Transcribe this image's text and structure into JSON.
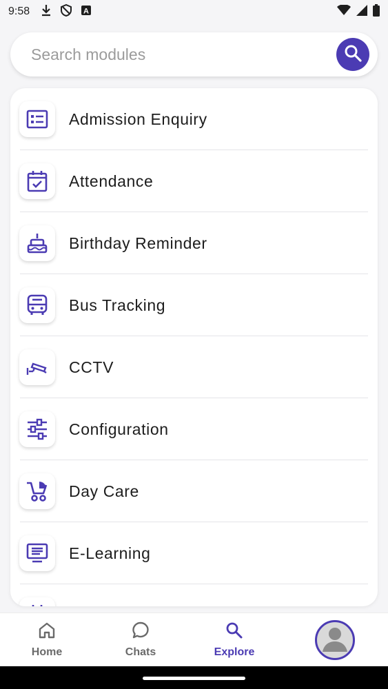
{
  "status_bar": {
    "time": "9:58",
    "icons_left": [
      "download-icon",
      "shield-icon",
      "app-a-icon"
    ],
    "icons_right": [
      "wifi-icon",
      "signal-icon",
      "battery-icon"
    ]
  },
  "search": {
    "placeholder": "Search modules",
    "value": ""
  },
  "modules": [
    {
      "label": "Admission Enquiry",
      "icon": "form-list-icon"
    },
    {
      "label": "Attendance",
      "icon": "calendar-check-icon"
    },
    {
      "label": "Birthday Reminder",
      "icon": "cake-icon"
    },
    {
      "label": "Bus Tracking",
      "icon": "bus-icon"
    },
    {
      "label": "CCTV",
      "icon": "cctv-camera-icon"
    },
    {
      "label": "Configuration",
      "icon": "sliders-icon"
    },
    {
      "label": "Day Care",
      "icon": "stroller-icon"
    },
    {
      "label": "E-Learning",
      "icon": "monitor-list-icon"
    },
    {
      "label": "",
      "icon": "calendar-icon"
    }
  ],
  "bottom_nav": {
    "items": [
      {
        "label": "Home",
        "icon": "home-icon",
        "active": false
      },
      {
        "label": "Chats",
        "icon": "chat-bubble-icon",
        "active": false
      },
      {
        "label": "Explore",
        "icon": "search-icon",
        "active": true
      }
    ],
    "avatar_icon": "avatar-icon"
  },
  "colors": {
    "accent": "#4b3bb3",
    "background": "#f5f5f7",
    "card": "#ffffff",
    "inactive_nav": "#6a6a6a"
  }
}
